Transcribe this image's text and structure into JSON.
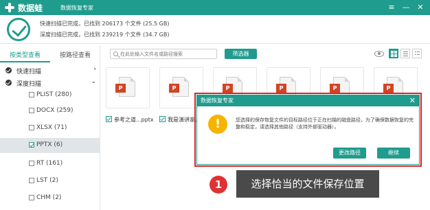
{
  "titlebar": {
    "app_name": "数据蛙",
    "window_subtitle": "数据恢复专家",
    "menu_icon": "hamburger-icon",
    "minimize_icon": "minus-icon",
    "close_icon": "close-icon"
  },
  "summary": {
    "quick_scan": "快速扫描已完成，已找到  206173  个文件 (25.5 GB)",
    "deep_scan": "深度扫描已完成，已找到  239219  个文件 (34.7 GB)"
  },
  "sidebar": {
    "tabs": [
      {
        "label": "按类型查看",
        "active": true
      },
      {
        "label": "按路径查看",
        "active": false
      }
    ],
    "tree": [
      {
        "label": "快速扫描",
        "arrow": "›"
      },
      {
        "label": "深度扫描",
        "arrow": "⌄"
      }
    ],
    "file_types": [
      {
        "label": "PLIST (280)",
        "selected": false
      },
      {
        "label": "DOCX (259)",
        "selected": false
      },
      {
        "label": "XLSX (71)",
        "selected": false
      },
      {
        "label": "PPTX (6)",
        "selected": true
      },
      {
        "label": "RT (161)",
        "selected": false
      },
      {
        "label": "LST (2)",
        "selected": false
      },
      {
        "label": "CHM (2)",
        "selected": false
      }
    ]
  },
  "toolbar": {
    "search_placeholder": "在此处输入文件名或路径搜索",
    "filter_label": "筛选器"
  },
  "files": [
    {
      "name": "参考之道...pptx",
      "icon_letter": "P"
    },
    {
      "name": "我是演讲家.p",
      "icon_letter": "P"
    },
    {
      "name": "",
      "icon_letter": "P"
    },
    {
      "name": "",
      "icon_letter": "P"
    },
    {
      "name": "",
      "icon_letter": "P"
    },
    {
      "name": "",
      "icon_letter": "P"
    }
  ],
  "dialog": {
    "title": "数据恢复专家",
    "message": "您选择的保存恢复文件的目标路径位于正在扫描的磁盘路径，为了确保数据恢复的完整和稳定，请选择其他路径（支持外部驱动器）。",
    "warning_glyph": "!",
    "change_path_label": "更改路径",
    "continue_label": "继续"
  },
  "annotation": {
    "number": "1",
    "text": "选择恰当的文件保存位置"
  },
  "colors": {
    "brand": "#1f9c8d",
    "alert_outline": "#e02020",
    "warning": "#f5b400",
    "ppt": "#d04525"
  }
}
